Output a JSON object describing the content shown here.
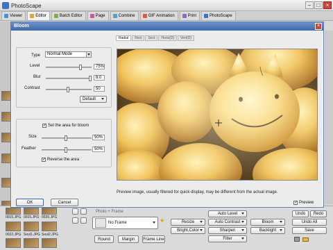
{
  "window": {
    "title": "PhotoScape"
  },
  "main_tabs": [
    {
      "label": "Viewer",
      "color": "#4a90d9"
    },
    {
      "label": "Editor",
      "color": "#d9a441"
    },
    {
      "label": "Batch Editor",
      "color": "#7fb04a"
    },
    {
      "label": "Page",
      "color": "#c45a9a"
    },
    {
      "label": "Combine",
      "color": "#5aa0c4"
    },
    {
      "label": "GIF Animation",
      "color": "#d95b4a"
    },
    {
      "label": "Print",
      "color": "#8a6bc4"
    },
    {
      "label": "PhotoScape",
      "color": "#3d73c6"
    }
  ],
  "dialog": {
    "title": "Bloom",
    "type": {
      "label": "Type",
      "value": "Normal Mode"
    },
    "level": {
      "label": "Level",
      "value": "75%",
      "fraction": 0.75
    },
    "blur": {
      "label": "Blur",
      "value": "8.0",
      "fraction": 0.98
    },
    "contrast": {
      "label": "Contrast",
      "value": "50",
      "fraction": 0.5
    },
    "preset": {
      "value": "Default"
    },
    "set_area": {
      "label": "Set the area for bloom",
      "checked": true
    },
    "size": {
      "label": "Size",
      "value": "50%",
      "fraction": 0.5
    },
    "feather": {
      "label": "Feather",
      "value": "50%",
      "fraction": 0.5
    },
    "reverse": {
      "label": "Reverse the area",
      "checked": true
    },
    "preview_tabs": [
      "Radial",
      "Rect",
      "Sect",
      "Horiz(D)",
      "Vert(D)"
    ],
    "note": "Preview image, usually filtered for quick display, may be different from the actual image.",
    "preview_check": {
      "label": "Preview",
      "checked": true
    },
    "ok": "OK",
    "cancel": "Cancel"
  },
  "bottom": {
    "filenames": [
      "0015.JPG",
      "0015.JPG",
      "0020.JPG",
      "0022.JPG",
      "Soul1.JPG",
      "Soul2.JPG"
    ],
    "photo_frame_label": "Photo + Frame",
    "frame_select": "No Frame",
    "round": "Round",
    "margin": "Margin",
    "frame_line": "Frame Line",
    "resize": "Resize",
    "bright_color": "Bright,Color",
    "auto_level": "Auto Level",
    "auto_contrast": "Auto Contrast",
    "sharpen": "Sharpen",
    "filter": "Filter",
    "bloom": "Bloom",
    "backlight": "Backlight",
    "undo": "Undo",
    "redo": "Redo",
    "undo_all": "Undo All",
    "save": "Save"
  }
}
